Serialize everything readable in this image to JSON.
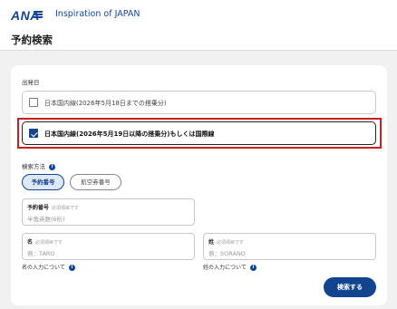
{
  "header": {
    "logo_text": "ANA",
    "tagline": "Inspiration of JAPAN"
  },
  "page": {
    "title": "予約検索"
  },
  "departure_section": {
    "label": "出発日",
    "options": [
      {
        "label": "日本国内線(2026年5月18日までの搭乗分)",
        "checked": false
      },
      {
        "label": "日本国内線(2026年5月19日以降の搭乗分)もしくは国際線",
        "checked": true
      }
    ]
  },
  "search_method": {
    "label": "検索方法",
    "tabs": [
      {
        "label": "予約番号",
        "active": true
      },
      {
        "label": "航空券番号",
        "active": false
      }
    ]
  },
  "fields": {
    "reservation_number": {
      "label": "予約番号",
      "required_note": "必須項目です",
      "placeholder": "半角英数(6桁)"
    },
    "first_name": {
      "label": "名",
      "required_note": "必須項目です",
      "placeholder": "例：TARO"
    },
    "last_name": {
      "label": "姓",
      "required_note": "必須項目です",
      "placeholder": "例：SORANO"
    }
  },
  "help": {
    "first_name_help": "名の入力について",
    "last_name_help": "姓の入力について"
  },
  "actions": {
    "search_label": "検索する"
  },
  "colors": {
    "brand": "#13448f",
    "highlight": "#c81e1e"
  }
}
